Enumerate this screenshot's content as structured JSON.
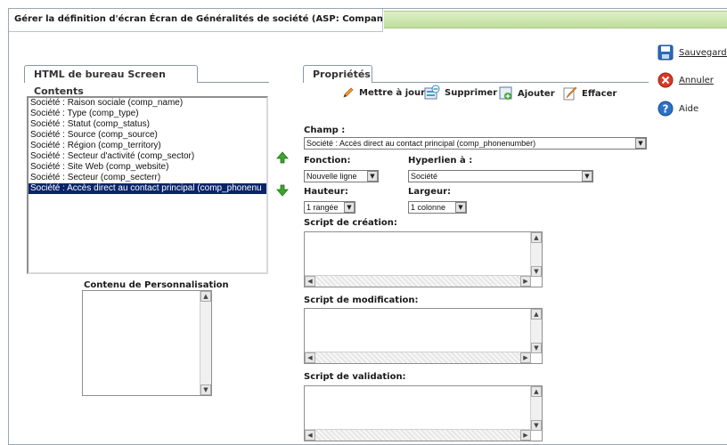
{
  "header": {
    "title": "Gérer la définition d'écran Écran de Généralités de société (ASP: CompanyBoxShort)"
  },
  "left_panel": {
    "tab_label": "HTML de bureau Screen Contents",
    "fields": [
      "Société : Raison sociale (comp_name)",
      "Société : Type (comp_type)",
      "Société : Statut (comp_status)",
      "Société : Source (comp_source)",
      "Société : Région (comp_territory)",
      "Société : Secteur d'activité (comp_sector)",
      "Société : Site Web (comp_website)",
      "Société : Secteur (comp_secterr)",
      "Société : Accès direct au contact principal (comp_phonenu"
    ],
    "selected_index": 8,
    "custom_label": "Contenu de Personnalisation"
  },
  "properties": {
    "tab_label": "Propriétés",
    "toolbar": {
      "update": "Mettre à jour",
      "delete": "Supprimer",
      "add": "Ajouter",
      "clear": "Effacer"
    },
    "champ_label": "Champ :",
    "champ_value": "Société : Accès direct au contact principal (comp_phonenumber)",
    "fonction_label": "Fonction:",
    "fonction_value": "Nouvelle ligne",
    "hyperlien_label": "Hyperlien à :",
    "hyperlien_value": "Société",
    "hauteur_label": "Hauteur:",
    "hauteur_value": "1 rangée",
    "largeur_label": "Largeur:",
    "largeur_value": "1 colonne",
    "create_script_label": "Script de création:",
    "modify_script_label": "Script de modification:",
    "validate_script_label": "Script de validation:"
  },
  "side_actions": {
    "save": "Sauvegarder",
    "cancel": "Annuler",
    "help": "Aide"
  },
  "colors": {
    "selection": "#0a246a",
    "title_bar": "#bedd9c",
    "move_arrow": "#3aa62c"
  }
}
